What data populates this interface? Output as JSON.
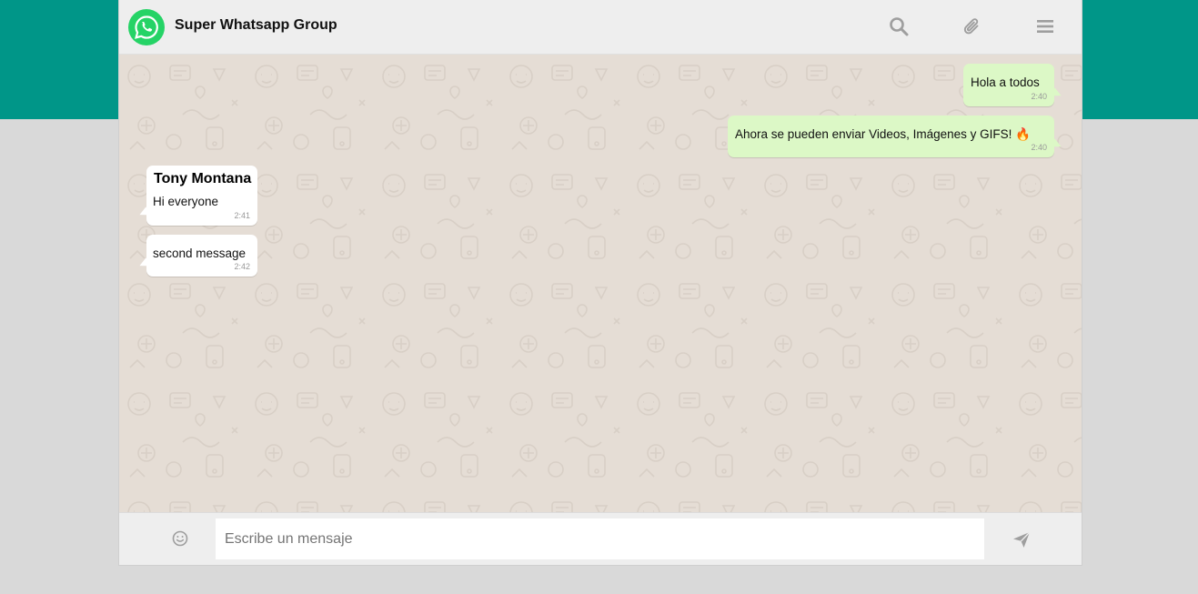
{
  "header": {
    "title": "Super Whatsapp Group",
    "icons": [
      "search-icon",
      "attach-icon",
      "menu-icon"
    ]
  },
  "messages": [
    {
      "direction": "out",
      "text": "Hola a todos",
      "time": "2:40"
    },
    {
      "direction": "out",
      "text": "Ahora se pueden enviar Videos, Imágenes y GIFS! 🔥",
      "time": "2:40"
    },
    {
      "direction": "in",
      "sender": "Tony Montana",
      "text": "Hi everyone",
      "time": "2:41"
    },
    {
      "direction": "in",
      "text": "second message",
      "time": "2:42"
    }
  ],
  "footer": {
    "input_placeholder": "Escribe un mensaje",
    "input_value": "",
    "icons": [
      "emoji-icon",
      "send-icon"
    ]
  },
  "colors": {
    "brand": "#009688",
    "outgoing_bubble": "#dcf8c6",
    "incoming_bubble": "#ffffff",
    "chat_background": "#e5ddd5",
    "icon_gray": "#9e9e9e"
  }
}
